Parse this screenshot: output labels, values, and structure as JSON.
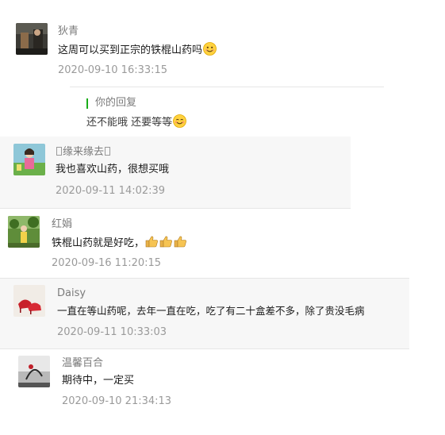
{
  "comments": [
    {
      "nickname": "狄青",
      "text": "这周可以买到正宗的铁棍山药吗",
      "time": "2020-09-10 16:33:15",
      "reply": {
        "label": "你的回复",
        "text": "还不能哦 还要等等"
      },
      "emoji": "smile-emoji"
    },
    {
      "nickname": "缘来缘去",
      "text": "我也喜欢山药，很想买哦",
      "time": "2020-09-11 14:02:39"
    },
    {
      "nickname": "红娟",
      "text": "铁棍山药就是好吃，",
      "time": "2020-09-16 11:20:15",
      "emoji": "thumbs-up-emoji"
    },
    {
      "nickname": "Daisy",
      "text": "一直在等山药呢，去年一直在吃，吃了有二十盒差不多，除了贵没毛病",
      "time": "2020-09-11 10:33:03"
    },
    {
      "nickname": "温馨百合",
      "text": "期待中，一定买",
      "time": "2020-09-10 21:34:13"
    }
  ],
  "colors": {
    "accent_reply_bar": "#1aad19",
    "nickname": "#7b7b7b",
    "timestamp": "#9a9a9a"
  }
}
